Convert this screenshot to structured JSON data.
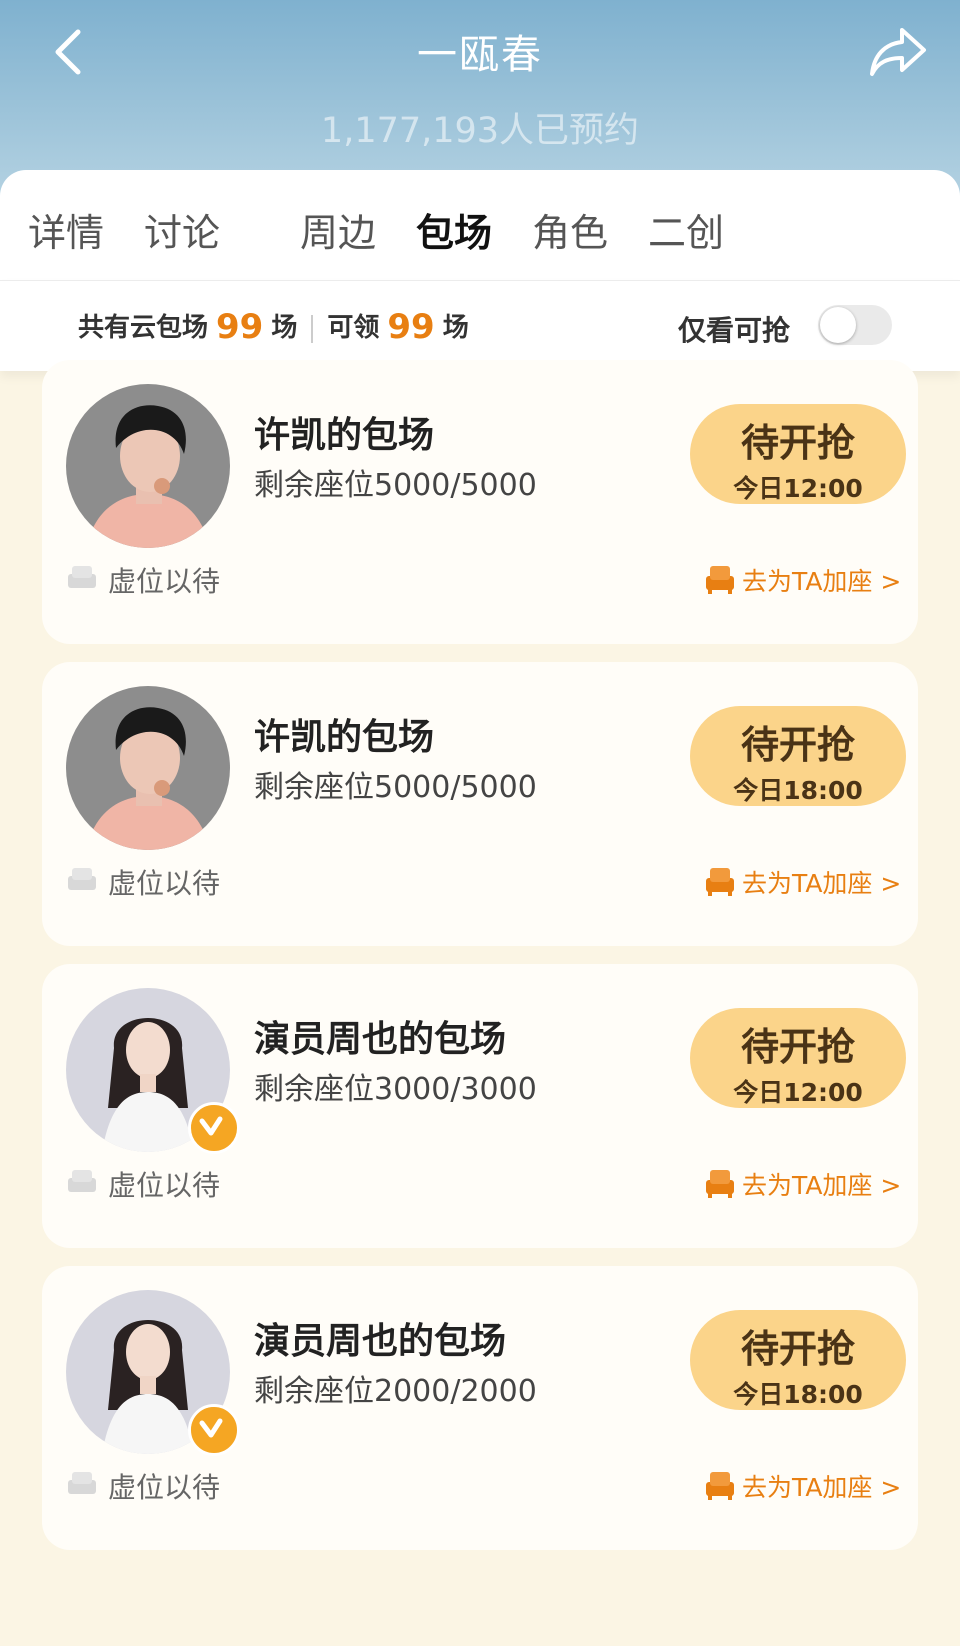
{
  "header": {
    "title": "一瓯春",
    "subtitle": "1,177,193人已预约"
  },
  "tabs": [
    {
      "label": "详情"
    },
    {
      "label": "讨论"
    },
    {
      "label": "周边"
    },
    {
      "label": "包场"
    },
    {
      "label": "角色"
    },
    {
      "label": "二创"
    }
  ],
  "active_tab": "包场",
  "summary": {
    "prefix": "共有云包场",
    "total": "99",
    "unit1": "场",
    "claimable_prefix": "可领",
    "claimable": "99",
    "unit2": "场",
    "toggle_label": "仅看可抢",
    "toggle_on": false
  },
  "colors": {
    "accent": "#e87f12",
    "button_bg": "#fbd48a",
    "page_bg": "#fbf5e4"
  },
  "cards": [
    {
      "title": "许凯的包场",
      "seats": "剩余座位5000/5000",
      "button": "待开抢",
      "time": "今日12:00",
      "empty_label": "虚位以待",
      "add_label": "去为TA加座 >",
      "avatar": "male-avatar"
    },
    {
      "title": "许凯的包场",
      "seats": "剩余座位5000/5000",
      "button": "待开抢",
      "time": "今日18:00",
      "empty_label": "虚位以待",
      "add_label": "去为TA加座 >",
      "avatar": "male-avatar"
    },
    {
      "title": "演员周也的包场",
      "seats": "剩余座位3000/3000",
      "button": "待开抢",
      "time": "今日12:00",
      "empty_label": "虚位以待",
      "add_label": "去为TA加座 >",
      "avatar": "female-avatar",
      "verified": true
    },
    {
      "title": "演员周也的包场",
      "seats": "剩余座位2000/2000",
      "button": "待开抢",
      "time": "今日18:00",
      "empty_label": "虚位以待",
      "add_label": "去为TA加座 >",
      "avatar": "female-avatar",
      "verified": true
    }
  ]
}
